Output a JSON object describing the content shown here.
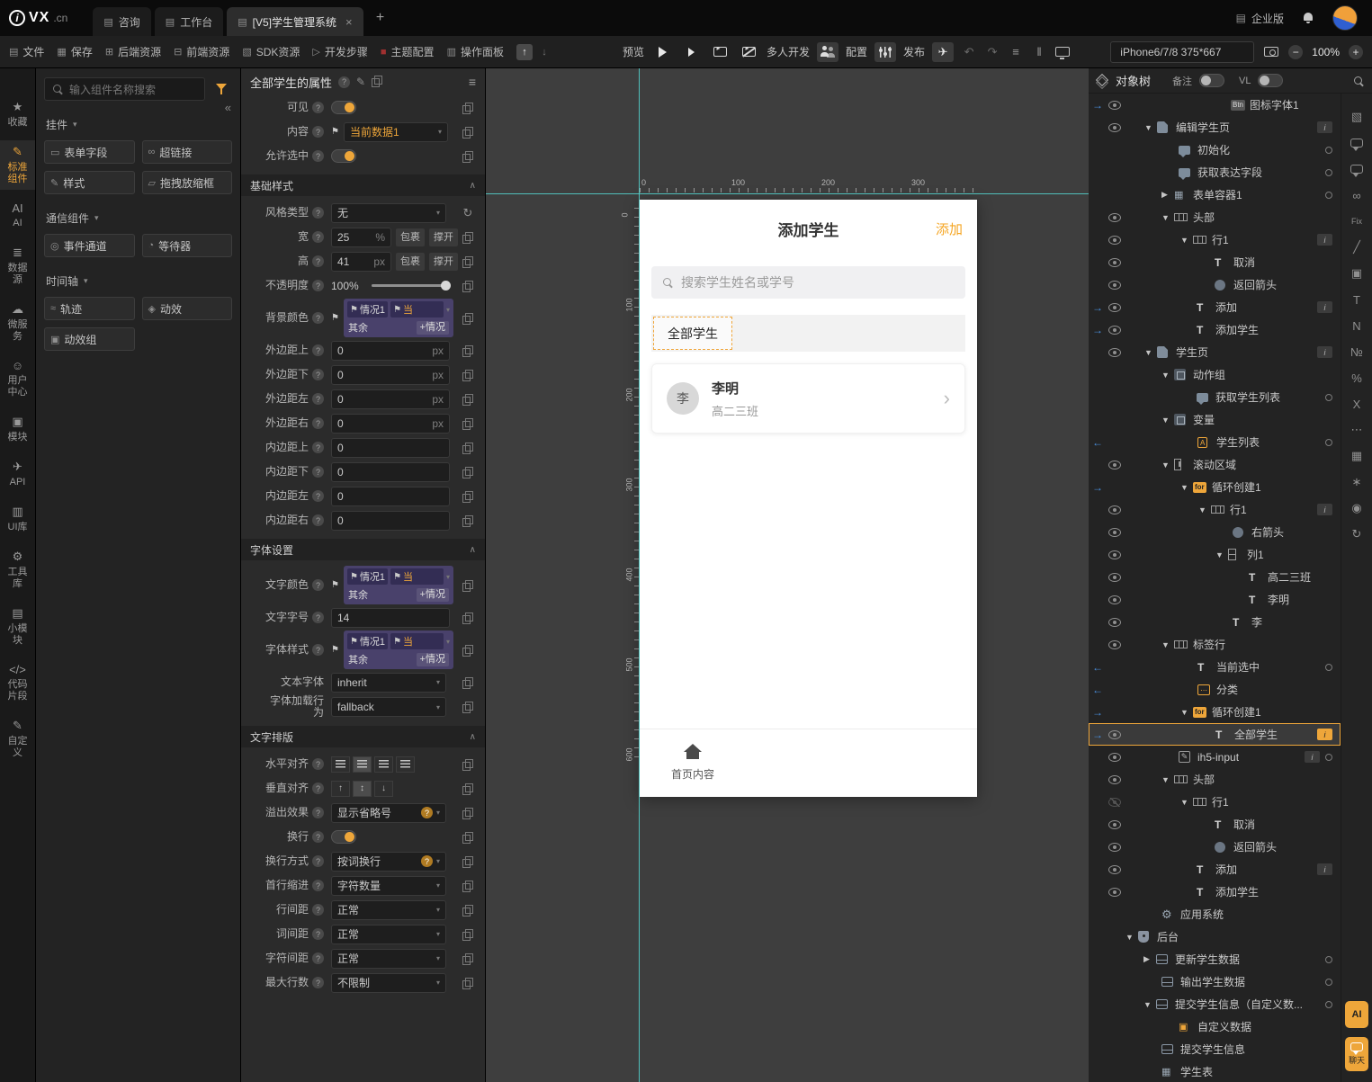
{
  "topbar": {
    "logo_i": "i",
    "logo_main": "VX",
    "logo_suffix": ".cn",
    "tabs": [
      {
        "label": "咨询",
        "active": false,
        "closable": false
      },
      {
        "label": "工作台",
        "active": false,
        "closable": false
      },
      {
        "label": "[V5]学生管理系统",
        "active": true,
        "closable": true
      }
    ],
    "new_tab_label": "+",
    "edition_label": "企业版"
  },
  "toolbar": {
    "file_items": [
      {
        "key": "file",
        "label": "文件"
      },
      {
        "key": "save",
        "label": "保存"
      },
      {
        "key": "backend-res",
        "label": "后端资源"
      },
      {
        "key": "frontend-res",
        "label": "前端资源"
      },
      {
        "key": "sdk-res",
        "label": "SDK资源"
      },
      {
        "key": "dev-steps",
        "label": "开发步骤"
      },
      {
        "key": "theme-config",
        "label": "主题配置"
      },
      {
        "key": "action-panel",
        "label": "操作面板"
      }
    ],
    "preview_label": "预览",
    "multidev_label": "多人开发",
    "config_label": "配置",
    "publish_label": "发布",
    "device_value": "iPhone6/7/8 375*667",
    "zoom_value": "100%"
  },
  "left_rail": [
    {
      "key": "favorites",
      "label": "收藏"
    },
    {
      "key": "standard-components",
      "label": "标准组件",
      "active": true
    },
    {
      "key": "ai",
      "label": "AI"
    },
    {
      "key": "data-source",
      "label": "数据源"
    },
    {
      "key": "microservice",
      "label": "微服务"
    },
    {
      "key": "user-center",
      "label": "用户中心"
    },
    {
      "key": "module",
      "label": "模块"
    },
    {
      "key": "api",
      "label": "API"
    },
    {
      "key": "ui-lib",
      "label": "UI库"
    },
    {
      "key": "tool-lib",
      "label": "工具库"
    },
    {
      "key": "small-module",
      "label": "小模块"
    },
    {
      "key": "code-snippet",
      "label": "代码片段"
    },
    {
      "key": "custom",
      "label": "自定义"
    }
  ],
  "components": {
    "search_placeholder": "输入组件名称搜索",
    "groups": [
      {
        "title": "挂件",
        "items": [
          {
            "key": "form-field",
            "label": "表单字段"
          },
          {
            "key": "hyperlink",
            "label": "超链接"
          },
          {
            "key": "style",
            "label": "样式"
          },
          {
            "key": "drag-resize",
            "label": "拖拽放缩框"
          }
        ]
      },
      {
        "title": "通信组件",
        "items": [
          {
            "key": "event-channel",
            "label": "事件通道"
          },
          {
            "key": "waiter",
            "label": "等待器"
          }
        ]
      },
      {
        "title": "时间轴",
        "items": [
          {
            "key": "track",
            "label": "轨迹"
          },
          {
            "key": "motion",
            "label": "动效"
          },
          {
            "key": "motion-group",
            "label": "动效组"
          }
        ]
      }
    ]
  },
  "properties": {
    "title": "全部学生的属性",
    "top_rows": [
      {
        "label": "可见",
        "type": "toggle",
        "on": true
      },
      {
        "label": "内容",
        "type": "flagselect",
        "value": "当前数据1"
      },
      {
        "label": "允许选中",
        "type": "toggle",
        "on": true
      }
    ],
    "sections": [
      {
        "title": "基础样式",
        "rows": [
          {
            "label": "风格类型",
            "type": "select",
            "value": "无",
            "refresh": true
          },
          {
            "label": "宽",
            "type": "dim",
            "value": "25",
            "unit": "%",
            "b1": "包裹",
            "b2": "撑开"
          },
          {
            "label": "高",
            "type": "dim",
            "value": "41",
            "unit": "px",
            "b1": "包裹",
            "b2": "撑开"
          },
          {
            "label": "不透明度",
            "type": "slider",
            "value": "100%"
          },
          {
            "label": "背景颜色",
            "type": "cond",
            "c1": "情况1",
            "cv": "当",
            "rest": "其余",
            "add": "+情况"
          },
          {
            "label": "外边距上",
            "type": "numunit",
            "value": "0",
            "unit": "px"
          },
          {
            "label": "外边距下",
            "type": "numunit",
            "value": "0",
            "unit": "px"
          },
          {
            "label": "外边距左",
            "type": "numunit",
            "value": "0",
            "unit": "px"
          },
          {
            "label": "外边距右",
            "type": "numunit",
            "value": "0",
            "unit": "px"
          },
          {
            "label": "内边距上",
            "type": "num",
            "value": "0"
          },
          {
            "label": "内边距下",
            "type": "num",
            "value": "0"
          },
          {
            "label": "内边距左",
            "type": "num",
            "value": "0"
          },
          {
            "label": "内边距右",
            "type": "num",
            "value": "0"
          }
        ]
      },
      {
        "title": "字体设置",
        "rows": [
          {
            "label": "文字颜色",
            "type": "cond",
            "c1": "情况1",
            "cv": "当",
            "rest": "其余",
            "add": "+情况"
          },
          {
            "label": "文字字号",
            "type": "num",
            "value": "14"
          },
          {
            "label": "字体样式",
            "type": "cond",
            "c1": "情况1",
            "cv": "当",
            "rest": "其余",
            "add": "+情况"
          },
          {
            "label": "文本字体",
            "type": "select",
            "value": "inherit",
            "noq": true
          },
          {
            "label": "字体加载行为",
            "type": "select",
            "value": "fallback",
            "noq": true
          }
        ]
      },
      {
        "title": "文字排版",
        "rows": [
          {
            "label": "水平对齐",
            "type": "halign"
          },
          {
            "label": "垂直对齐",
            "type": "valign"
          },
          {
            "label": "溢出效果",
            "type": "select",
            "value": "显示省略号",
            "q2": true
          },
          {
            "label": "换行",
            "type": "toggle",
            "on": true
          },
          {
            "label": "换行方式",
            "type": "select",
            "value": "按词换行",
            "q2": true
          },
          {
            "label": "首行缩进",
            "type": "select",
            "value": "字符数量"
          },
          {
            "label": "行间距",
            "type": "select",
            "value": "正常"
          },
          {
            "label": "词间距",
            "type": "select",
            "value": "正常"
          },
          {
            "label": "字符间距",
            "type": "select",
            "value": "正常"
          },
          {
            "label": "最大行数",
            "type": "select",
            "value": "不限制"
          }
        ]
      }
    ]
  },
  "canvas": {
    "ruler_top": [
      "0",
      "100",
      "200",
      "300"
    ],
    "ruler_left": [
      "0",
      "100",
      "200",
      "300",
      "400",
      "500",
      "600"
    ],
    "phone": {
      "title": "添加学生",
      "add_link": "添加",
      "search_placeholder": "搜索学生姓名或学号",
      "tab_all": "全部学生",
      "student_avatar": "李",
      "student_name": "李明",
      "student_class": "高二三班",
      "footer_label": "首页内容"
    }
  },
  "tree": {
    "title": "对象树",
    "note_label": "备注",
    "vl_label": "VL",
    "nodes": [
      {
        "pad": 120,
        "icon": "btn",
        "label": "图标字体1",
        "arrow": "in",
        "eye": true
      },
      {
        "pad": 24,
        "expand": "d",
        "icon": "page",
        "label": "编辑学生页",
        "eye": true,
        "info": true
      },
      {
        "pad": 62,
        "icon": "service",
        "label": "初始化",
        "circle": true
      },
      {
        "pad": 62,
        "icon": "service",
        "label": "获取表达字段",
        "circle": true
      },
      {
        "pad": 43,
        "expand": "r",
        "icon": "grid",
        "label": "表单容器1",
        "circle": true
      },
      {
        "pad": 43,
        "expand": "d",
        "icon": "row",
        "label": "头部",
        "eye": true
      },
      {
        "pad": 64,
        "expand": "d",
        "icon": "row",
        "label": "行1",
        "eye": true,
        "info": true
      },
      {
        "pad": 102,
        "icon": "text",
        "label": "取消",
        "eye": true
      },
      {
        "pad": 102,
        "icon": "circleicon",
        "label": "返回箭头",
        "eye": true
      },
      {
        "pad": 82,
        "icon": "text",
        "label": "添加",
        "arrow": "in",
        "eye": true,
        "info": true
      },
      {
        "pad": 82,
        "icon": "text",
        "label": "添加学生",
        "arrow": "in",
        "eye": true
      },
      {
        "pad": 24,
        "expand": "d",
        "icon": "page",
        "label": "学生页",
        "eye": true,
        "info": true
      },
      {
        "pad": 43,
        "expand": "d",
        "icon": "group",
        "label": "动作组"
      },
      {
        "pad": 82,
        "icon": "service",
        "label": "获取学生列表",
        "circle": true
      },
      {
        "pad": 43,
        "expand": "d",
        "icon": "group",
        "label": "变量"
      },
      {
        "pad": 83,
        "icon": "array",
        "label": "学生列表",
        "arrow": "out",
        "circle": true
      },
      {
        "pad": 43,
        "expand": "d",
        "icon": "scroll",
        "label": "滚动区域",
        "eye": true
      },
      {
        "pad": 64,
        "expand": "d",
        "icon": "for",
        "label": "循环创建1",
        "arrow": "in"
      },
      {
        "pad": 84,
        "expand": "d",
        "icon": "row",
        "label": "行1",
        "eye": true,
        "info": true
      },
      {
        "pad": 122,
        "icon": "circleicon",
        "label": "右箭头",
        "eye": true
      },
      {
        "pad": 103,
        "expand": "d",
        "icon": "col",
        "label": "列1",
        "eye": true
      },
      {
        "pad": 140,
        "icon": "text",
        "label": "高二三班",
        "eye": true
      },
      {
        "pad": 140,
        "icon": "text",
        "label": "李明",
        "eye": true
      },
      {
        "pad": 122,
        "icon": "text",
        "label": "李",
        "eye": true
      },
      {
        "pad": 43,
        "expand": "d",
        "icon": "row",
        "label": "标签行",
        "eye": true
      },
      {
        "pad": 83,
        "icon": "text",
        "label": "当前选中",
        "arrow": "out",
        "circle": true
      },
      {
        "pad": 83,
        "icon": "dots",
        "label": "分类",
        "arrow": "out"
      },
      {
        "pad": 64,
        "expand": "d",
        "icon": "for",
        "label": "循环创建1",
        "arrow": "in"
      },
      {
        "pad": 103,
        "icon": "text",
        "label": "全部学生",
        "arrow": "in",
        "eye": true,
        "info": true,
        "selected": true
      },
      {
        "pad": 62,
        "icon": "input",
        "label": "ih5-input",
        "eye": true,
        "info": true,
        "circle": true
      },
      {
        "pad": 43,
        "expand": "d",
        "icon": "row",
        "label": "头部",
        "eye": true
      },
      {
        "pad": 64,
        "expand": "d",
        "icon": "row",
        "label": "行1",
        "eyeoff": true
      },
      {
        "pad": 102,
        "icon": "text",
        "label": "取消",
        "eye": true
      },
      {
        "pad": 102,
        "icon": "circleicon",
        "label": "返回箭头",
        "eye": true
      },
      {
        "pad": 82,
        "icon": "text",
        "label": "添加",
        "eye": true,
        "info": true
      },
      {
        "pad": 82,
        "icon": "text",
        "label": "添加学生",
        "eye": true
      },
      {
        "pad": 43,
        "icon": "gear",
        "label": "应用系统"
      },
      {
        "pad": 3,
        "expand": "d",
        "icon": "shield",
        "label": "后台"
      },
      {
        "pad": 23,
        "expand": "r",
        "icon": "server",
        "label": "更新学生数据",
        "circle": true
      },
      {
        "pad": 43,
        "icon": "server",
        "label": "输出学生数据",
        "circle": true
      },
      {
        "pad": 23,
        "expand": "d",
        "icon": "server",
        "label": "提交学生信息（自定义数...",
        "circle": true
      },
      {
        "pad": 62,
        "icon": "cube",
        "label": "自定义数据"
      },
      {
        "pad": 43,
        "icon": "server",
        "label": "提交学生信息"
      },
      {
        "pad": 43,
        "icon": "table",
        "label": "学生表"
      }
    ]
  },
  "right_strip": {
    "icons": [
      "package",
      "chat",
      "chat2",
      "link",
      "fix",
      "ruler",
      "image",
      "text",
      "n",
      "number",
      "percent",
      "x",
      "list",
      "grid",
      "asterisk",
      "pin",
      "clock"
    ],
    "ai_label": "AI",
    "chat_label": "聊天"
  }
}
